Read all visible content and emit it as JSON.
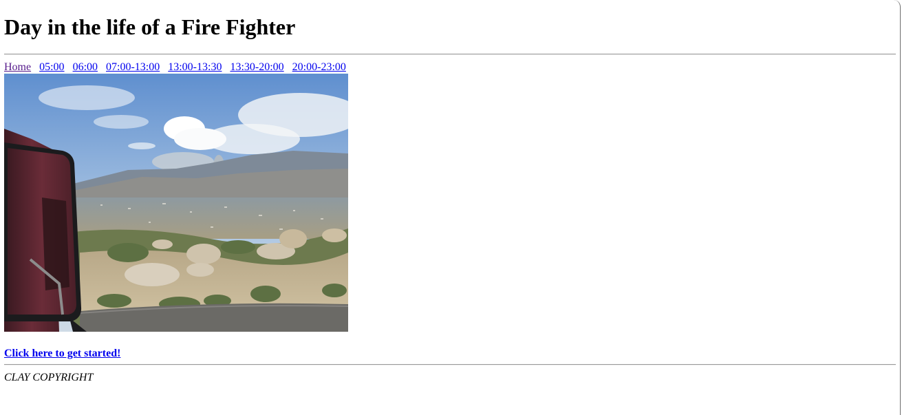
{
  "page": {
    "title": "Day in the life of a Fire Fighter"
  },
  "nav": {
    "links": [
      "Home",
      "05:00",
      "06:00",
      "07:00-13:00",
      "13:00-13:30",
      "13:30-20:00",
      "20:00-23:00"
    ]
  },
  "photo": {
    "icon": "landscape-photo-fire-smoke"
  },
  "cta": {
    "label": "Click here to get started!"
  },
  "footer": {
    "text": "CLAY COPYRIGHT"
  },
  "colors": {
    "link": "#0000ee",
    "visited_link": "#551a8b",
    "rule": "#9a9a9a"
  }
}
